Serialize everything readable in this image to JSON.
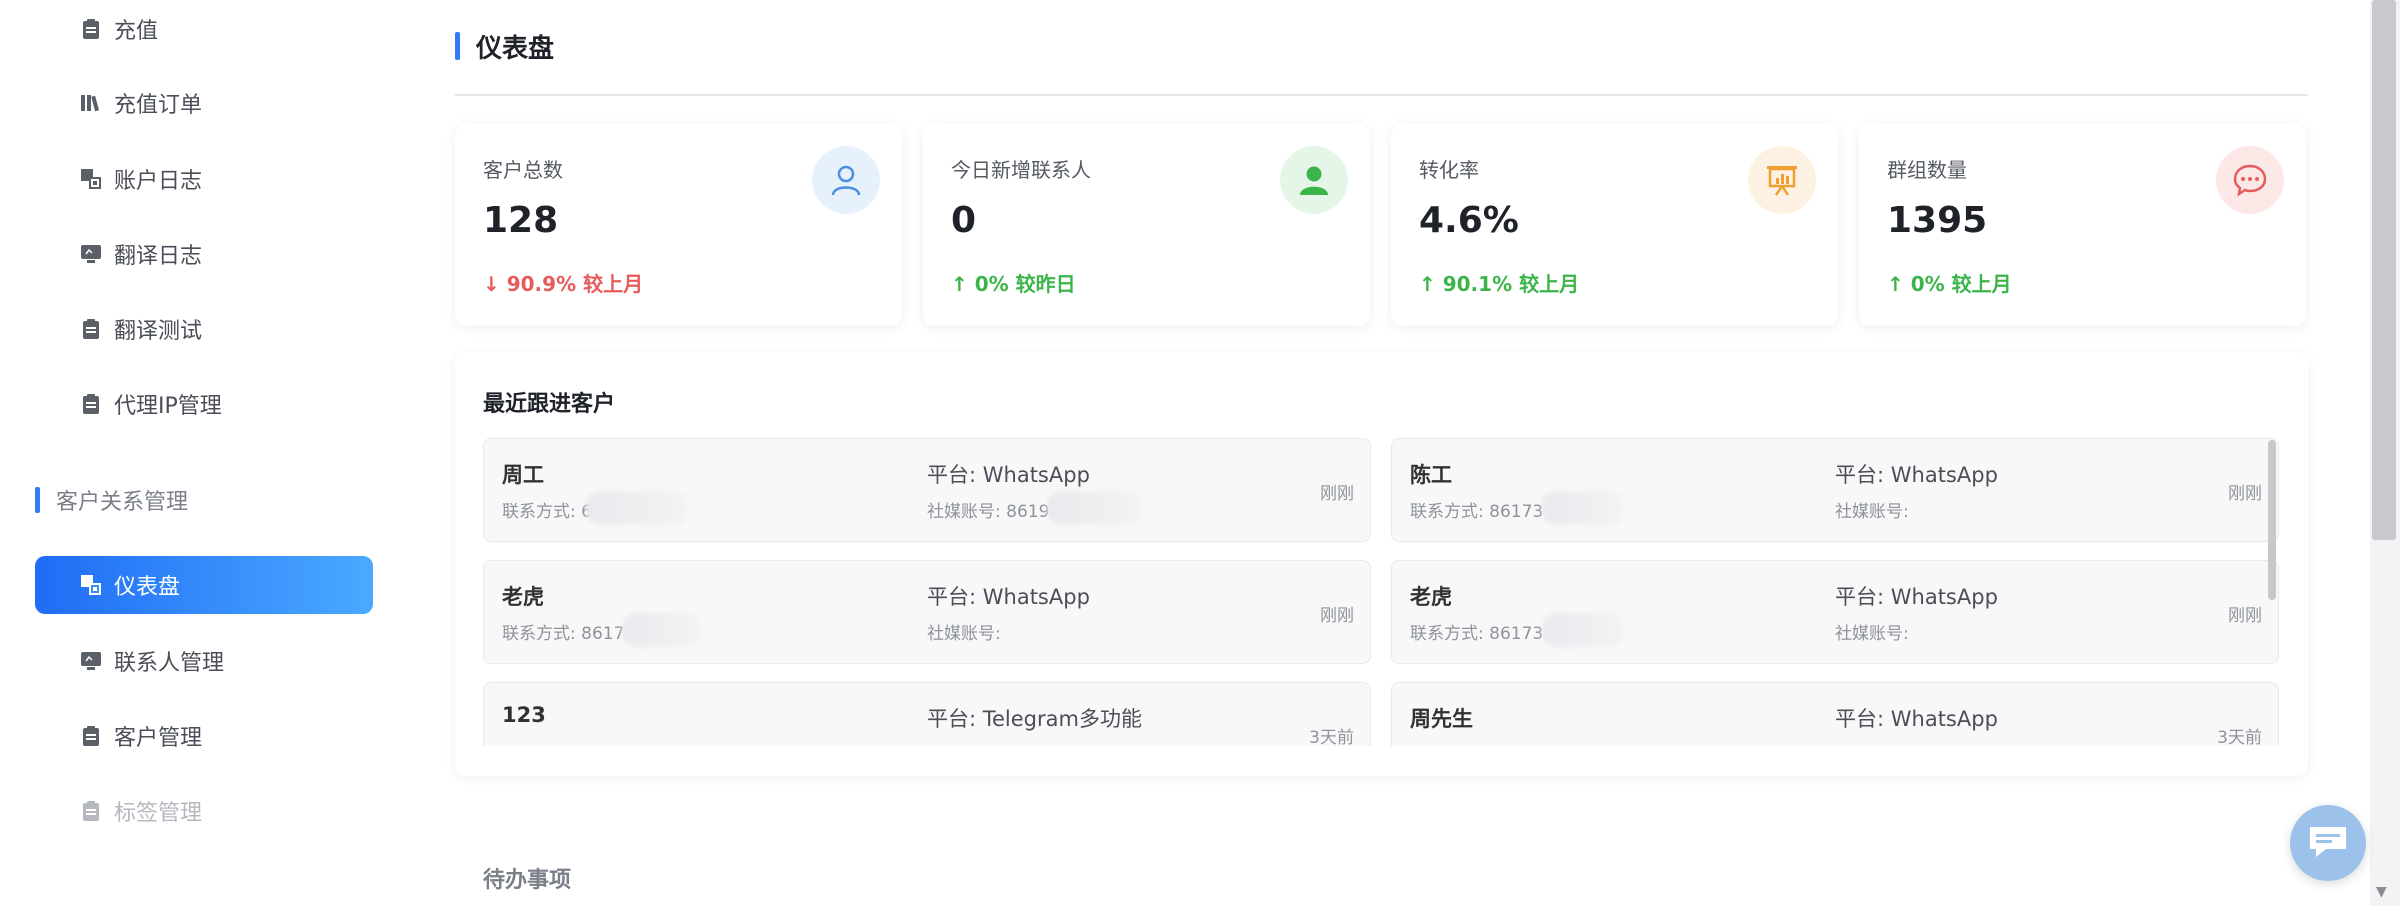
{
  "sidebar": {
    "items": [
      {
        "label": "充值",
        "icon": "clipboard-icon"
      },
      {
        "label": "充值订单",
        "icon": "books-icon"
      },
      {
        "label": "账户日志",
        "icon": "log-icon"
      },
      {
        "label": "翻译日志",
        "icon": "monitor-icon"
      },
      {
        "label": "翻译测试",
        "icon": "clipboard-icon"
      },
      {
        "label": "代理IP管理",
        "icon": "clipboard-icon"
      }
    ],
    "group_label": "客户关系管理",
    "group_items": [
      {
        "label": "仪表盘",
        "icon": "dashboard-icon",
        "active": true
      },
      {
        "label": "联系人管理",
        "icon": "monitor-icon"
      },
      {
        "label": "客户管理",
        "icon": "clipboard-icon"
      },
      {
        "label": "标签管理",
        "icon": "clipboard-icon"
      }
    ]
  },
  "main": {
    "page_title": "仪表盘",
    "stats": [
      {
        "label": "客户总数",
        "value": "128",
        "trend": "↓ 90.9% 较上月",
        "direction": "down",
        "icon": "user-outline-icon",
        "icon_color": "#4a90e2",
        "icon_bg": "#e6f1fc"
      },
      {
        "label": "今日新增联系人",
        "value": "0",
        "trend": "↑ 0% 较昨日",
        "direction": "up",
        "icon": "user-filled-icon",
        "icon_color": "#3bb54a",
        "icon_bg": "#e5f5e7"
      },
      {
        "label": "转化率",
        "value": "4.6%",
        "trend": "↑ 90.1% 较上月",
        "direction": "up",
        "icon": "presentation-icon",
        "icon_color": "#f0a030",
        "icon_bg": "#fdf1e3"
      },
      {
        "label": "群组数量",
        "value": "1395",
        "trend": "↑ 0% 较上月",
        "direction": "up",
        "icon": "chat-bubble-icon",
        "icon_color": "#e85b5b",
        "icon_bg": "#fde8e8"
      }
    ],
    "recent": {
      "title": "最近跟进客户",
      "customers": [
        {
          "name": "周工",
          "contact": "联系方式: 6",
          "platform": "平台: WhatsApp",
          "social": "社媒账号: 8619",
          "time": "刚刚"
        },
        {
          "name": "陈工",
          "contact": "联系方式: 86173",
          "platform": "平台: WhatsApp",
          "social": "社媒账号:",
          "time": "刚刚"
        },
        {
          "name": "老虎",
          "contact": "联系方式: 8617",
          "platform": "平台: WhatsApp",
          "social": "社媒账号:",
          "time": "刚刚"
        },
        {
          "name": "老虎",
          "contact": "联系方式: 86173",
          "platform": "平台: WhatsApp",
          "social": "社媒账号:",
          "time": "刚刚"
        },
        {
          "name": "123",
          "contact": "",
          "platform": "平台: Telegram多功能",
          "social": "",
          "time": "3天前"
        },
        {
          "name": "周先生",
          "contact": "",
          "platform": "平台: WhatsApp",
          "social": "",
          "time": "3天前"
        }
      ]
    },
    "todo_title": "待办事项"
  },
  "colors": {
    "accent": "#2f7cf6",
    "active_gradient_start": "#1f6cf5",
    "active_gradient_end": "#4aa9ff",
    "trend_down": "#e85b5b",
    "trend_up": "#3bb54a"
  }
}
